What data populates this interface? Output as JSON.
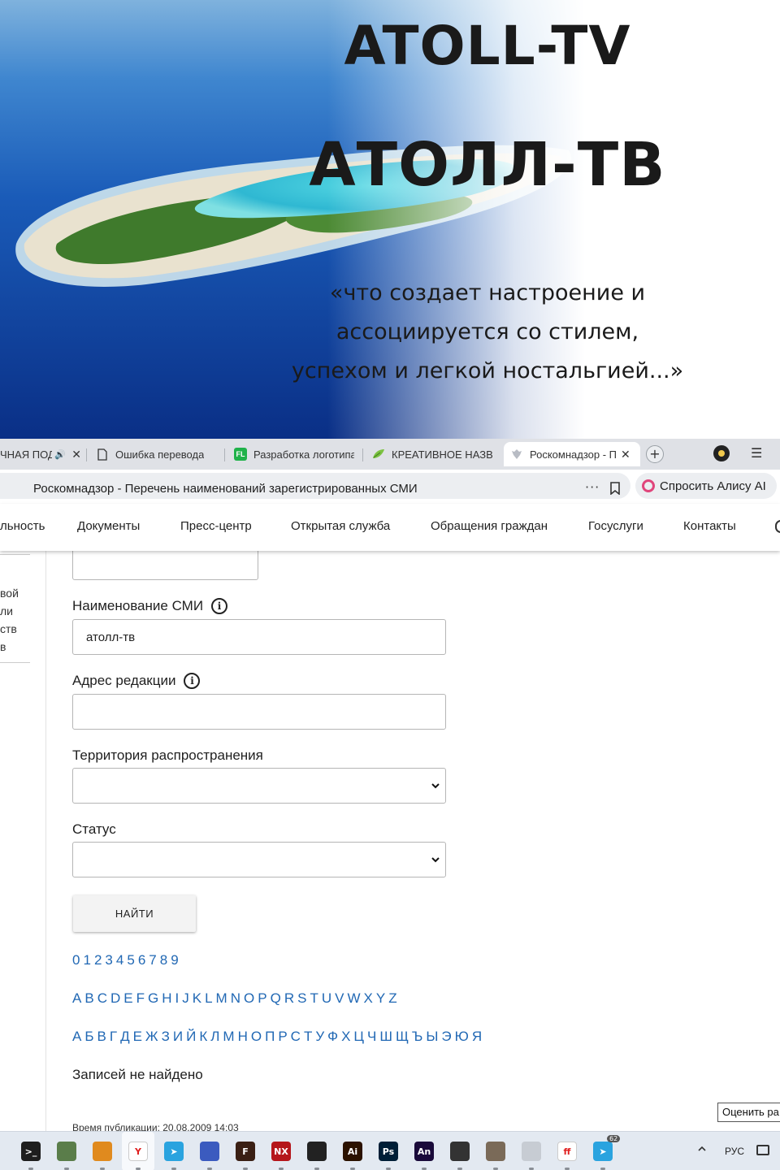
{
  "hero": {
    "title_latin": "ATOLL-TV",
    "title_cyrillic": "АТОЛЛ-ТВ",
    "quote_lines": [
      "«что создает настроение и",
      "ассоциируется со стилем,",
      "успехом и легкой ностальгией...»"
    ]
  },
  "browser": {
    "tabs": [
      {
        "label": "ЧНАЯ ПОД",
        "icon": "speaker-icon",
        "closable": true
      },
      {
        "label": "Ошибка перевода",
        "icon": "document-icon"
      },
      {
        "label": "Разработка логотипа",
        "icon": "fl-icon",
        "icon_text": "FL"
      },
      {
        "label": "КРЕАТИВНОЕ НАЗВ",
        "icon": "leaf-icon"
      },
      {
        "label": "Роскомнадзор - П",
        "icon": "emblem-icon",
        "closable": true,
        "active": true
      }
    ],
    "close_glyph": "✕",
    "add_glyph": "+",
    "menu_glyph": "☰",
    "address": "Роскомнадзор - Перечень наименований зарегистрированных СМИ",
    "address_more": "···",
    "alice_label": "Спросить Алису AI"
  },
  "nav": {
    "items": [
      "льность",
      "Документы",
      "Пресс-центр",
      "Открытая служба",
      "Обращения граждан",
      "Госуслуги",
      "Контакты"
    ]
  },
  "sidebar_fragments": [
    "вой",
    "ли",
    "ств",
    "в"
  ],
  "form": {
    "name_label": "Наименование СМИ",
    "name_value": "атолл-тв",
    "address_label": "Адрес редакции",
    "address_value": "",
    "territory_label": "Территория распространения",
    "territory_value": "",
    "status_label": "Статус",
    "status_value": "",
    "info_glyph": "i",
    "find_button": "НАЙТИ"
  },
  "alphabet": {
    "digits": [
      "0",
      "1",
      "2",
      "3",
      "4",
      "5",
      "6",
      "7",
      "8",
      "9"
    ],
    "latin": [
      "A",
      "B",
      "C",
      "D",
      "E",
      "F",
      "G",
      "H",
      "I",
      "J",
      "K",
      "L",
      "M",
      "N",
      "O",
      "P",
      "Q",
      "R",
      "S",
      "T",
      "U",
      "V",
      "W",
      "X",
      "Y",
      "Z"
    ],
    "cyrillic": [
      "А",
      "Б",
      "В",
      "Г",
      "Д",
      "Е",
      "Ж",
      "З",
      "И",
      "Й",
      "К",
      "Л",
      "М",
      "Н",
      "О",
      "П",
      "Р",
      "С",
      "Т",
      "У",
      "Ф",
      "Х",
      "Ц",
      "Ч",
      "Ш",
      "Щ",
      "Ъ",
      "Ы",
      "Э",
      "Ю",
      "Я"
    ]
  },
  "results": {
    "empty_text": "Записей не найдено",
    "publication_time": "Время публикации: 20.08.2009 14:03"
  },
  "feedback_button": "Оценить ра",
  "taskbar": {
    "language": "РУС",
    "telegram_badge": "62",
    "apps": [
      {
        "name": "terminal-icon",
        "color": "#1e1e1e",
        "text": ">_"
      },
      {
        "name": "archive-icon",
        "color": "#5a7d4a",
        "text": ""
      },
      {
        "name": "box-icon",
        "color": "#e08a1e",
        "text": ""
      },
      {
        "name": "yandex-browser-icon",
        "color": "#ffffff",
        "text": "Y"
      },
      {
        "name": "telegram-icon",
        "color": "#2aa3df",
        "text": "➤"
      },
      {
        "name": "floppy-icon",
        "color": "#3b5bbf",
        "text": ""
      },
      {
        "name": "f-app-icon",
        "color": "#3a1f14",
        "text": "F"
      },
      {
        "name": "nx-icon",
        "color": "#b5161b",
        "text": "NX"
      },
      {
        "name": "rhino-icon",
        "color": "#222222",
        "text": ""
      },
      {
        "name": "illustrator-icon",
        "color": "#2b1200",
        "text": "Ai"
      },
      {
        "name": "photoshop-icon",
        "color": "#001e36",
        "text": "Ps"
      },
      {
        "name": "animate-icon",
        "color": "#1a0a3a",
        "text": "An"
      },
      {
        "name": "inkscape-icon",
        "color": "#333333",
        "text": ""
      },
      {
        "name": "gimp-icon",
        "color": "#7a6a58",
        "text": ""
      },
      {
        "name": "calculator-icon",
        "color": "#c7ccd3",
        "text": ""
      },
      {
        "name": "fontforge-icon",
        "color": "#ffffff",
        "text": "ff"
      },
      {
        "name": "telegram-2-icon",
        "color": "#2aa3df",
        "text": "➤"
      }
    ]
  },
  "colors": {
    "link": "#2168b4",
    "ocean_deep": "#0c3a8c",
    "ocean_mid": "#1e64c0",
    "lagoon": "#39c3d6"
  }
}
